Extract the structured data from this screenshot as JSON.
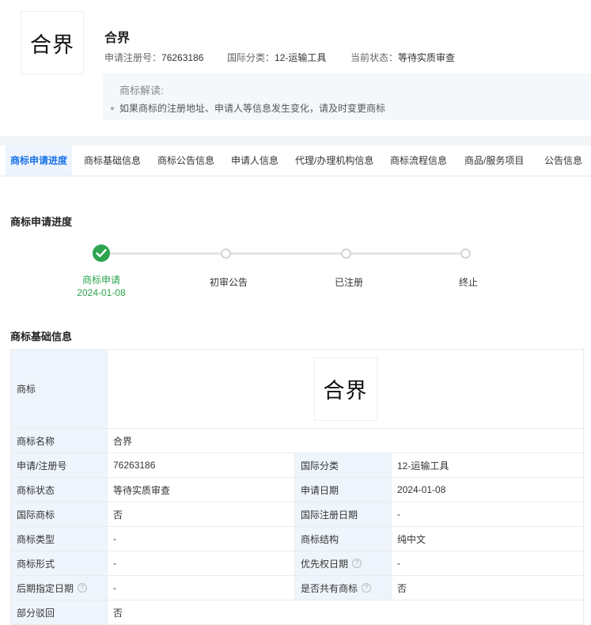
{
  "header": {
    "logo_text": "合界",
    "name": "合界",
    "reg_no_label": "申请注册号：",
    "reg_no": "76263186",
    "class_label": "国际分类：",
    "class_value": "12-运输工具",
    "status_label": "当前状态：",
    "status_value": "等待实质审查"
  },
  "interpretation": {
    "title": "商标解读:",
    "tip": "如果商标的注册地址、申请人等信息发生变化，请及时变更商标"
  },
  "tabs": [
    {
      "label": "商标申请进度",
      "active": true
    },
    {
      "label": "商标基础信息"
    },
    {
      "label": "商标公告信息"
    },
    {
      "label": "申请人信息"
    },
    {
      "label": "代理/办理机构信息"
    },
    {
      "label": "商标流程信息"
    },
    {
      "label": "商品/服务项目"
    },
    {
      "label": "公告信息"
    }
  ],
  "progress": {
    "title": "商标申请进度",
    "steps": [
      {
        "label": "商标申请",
        "date": "2024-01-08",
        "done": true
      },
      {
        "label": "初审公告",
        "date": ""
      },
      {
        "label": "已注册",
        "date": ""
      },
      {
        "label": "终止",
        "date": ""
      }
    ]
  },
  "basic": {
    "title": "商标基础信息",
    "logo_label": "商标",
    "logo_text": "合界",
    "name_label": "商标名称",
    "name_value": "合界",
    "rows": [
      {
        "k1": "申请/注册号",
        "v1": "76263186",
        "k2": "国际分类",
        "v2": "12-运输工具"
      },
      {
        "k1": "商标状态",
        "v1": "等待实质审查",
        "k2": "申请日期",
        "v2": "2024-01-08"
      },
      {
        "k1": "国际商标",
        "v1": "否",
        "k2": "国际注册日期",
        "v2": "-"
      },
      {
        "k1": "商标类型",
        "v1": "-",
        "k2": "商标结构",
        "v2": "纯中文"
      },
      {
        "k1": "商标形式",
        "v1": "-",
        "k2": "优先权日期",
        "v2": "-"
      },
      {
        "k1": "后期指定日期",
        "v1": "-",
        "k2": "是否共有商标",
        "v2": "否"
      }
    ],
    "last_label": "部分驳回",
    "last_value": "否",
    "help_icon": "?"
  },
  "colors": {
    "accent": "#1a73e8",
    "success": "#2ea44f",
    "key_bg": "#eef5fc"
  }
}
